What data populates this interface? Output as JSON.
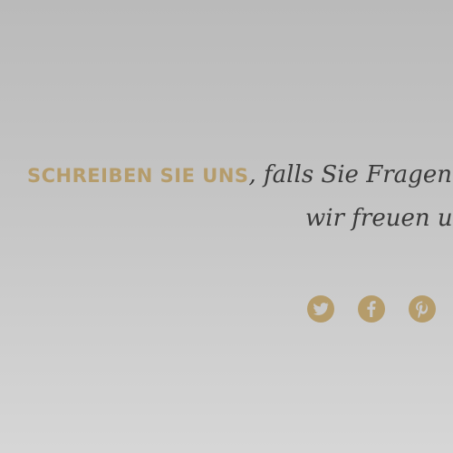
{
  "contact": {
    "cta": "SCHREIBEN SIE UNS",
    "line1": ", falls Sie Fragen",
    "line2": "wir freuen u"
  },
  "social": {
    "items": [
      {
        "name": "twitter-icon"
      },
      {
        "name": "facebook-icon"
      },
      {
        "name": "pinterest-icon"
      }
    ]
  },
  "colors": {
    "accent": "#b59c6b",
    "text": "#3a3a3a"
  }
}
